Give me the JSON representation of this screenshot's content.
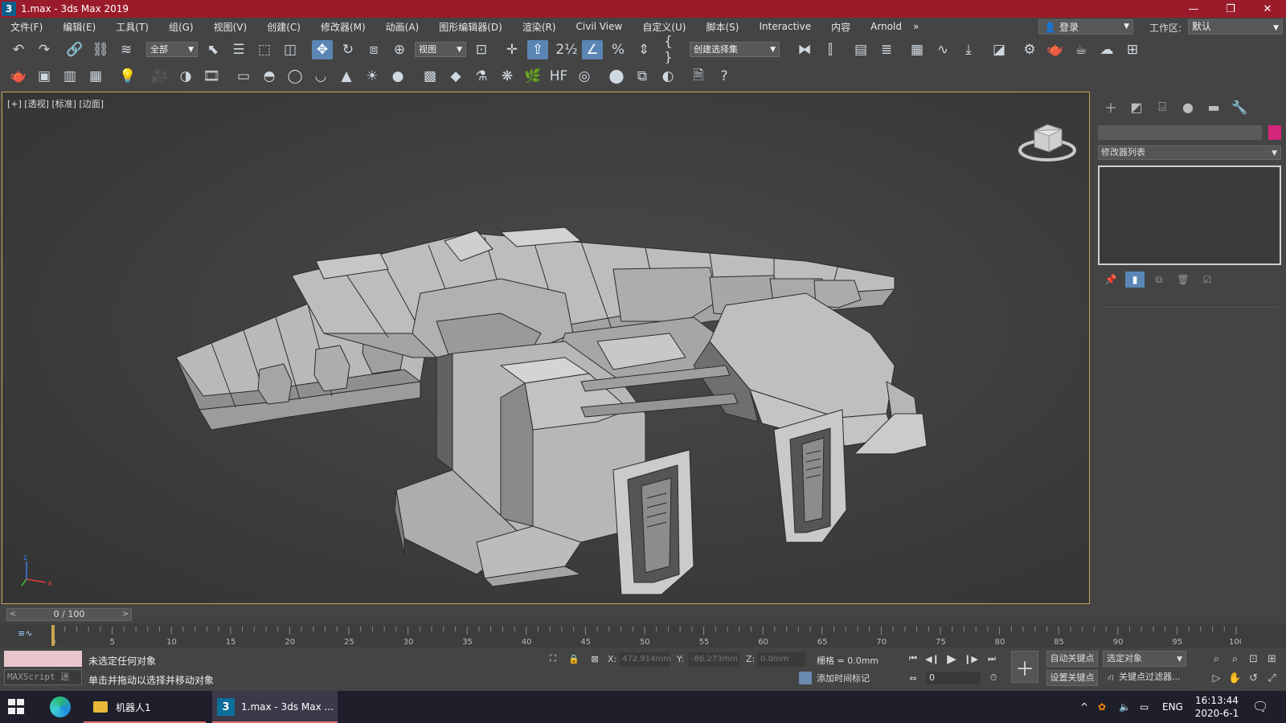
{
  "window": {
    "app_icon": "3",
    "title": "1.max - 3ds Max 2019",
    "minimize": "—",
    "restore": "❐",
    "close": "✕"
  },
  "menu": [
    "文件(F)",
    "编辑(E)",
    "工具(T)",
    "组(G)",
    "视图(V)",
    "创建(C)",
    "修改器(M)",
    "动画(A)",
    "图形编辑器(D)",
    "渲染(R)",
    "Civil View",
    "自定义(U)",
    "脚本(S)",
    "Interactive",
    "内容",
    "Arnold"
  ],
  "menu_overflow": "»",
  "login_label": "登录",
  "workspace": {
    "label": "工作区:",
    "value": "默认"
  },
  "main_toolbar": {
    "selection_filter": "全部",
    "ref_coord": "视图",
    "named_selection": "创建选择集"
  },
  "viewport": {
    "label": "[+] [透视] [标准] [边面]",
    "axis_z": "z",
    "axis_x": "x"
  },
  "command_panel": {
    "modifier_list": "修改器列表"
  },
  "time_slider": {
    "value": "0 / 100",
    "prev": "<",
    "next": ">"
  },
  "track_ticks": [
    "0",
    "5",
    "10",
    "15",
    "20",
    "25",
    "30",
    "35",
    "40",
    "45",
    "50",
    "55",
    "60",
    "65",
    "70",
    "75",
    "80",
    "85",
    "90",
    "95",
    "100"
  ],
  "status": {
    "maxscript_label": "MAXScript 迷",
    "line1": "未选定任何对象",
    "line2": "单击并拖动以选择并移动对象",
    "x_label": "X:",
    "x_value": "472.914mm",
    "y_label": "Y:",
    "y_value": "-86.273mm",
    "z_label": "Z:",
    "z_value": "0.0mm",
    "grid": "栅格 = 0.0mm",
    "add_time_tag": "添加时间标记"
  },
  "anim_controls": {
    "auto_key": "自动关键点",
    "set_key": "设置关键点",
    "selected_object": "选定对象",
    "key_filters": "关键点过滤器...",
    "frame": "0"
  },
  "taskbar": {
    "item1": "机器人1",
    "item2": "1.max - 3ds Max ...",
    "lang": "ENG",
    "time": "16:13:44",
    "date": "2020-6-1",
    "tray_chevron": "^"
  }
}
